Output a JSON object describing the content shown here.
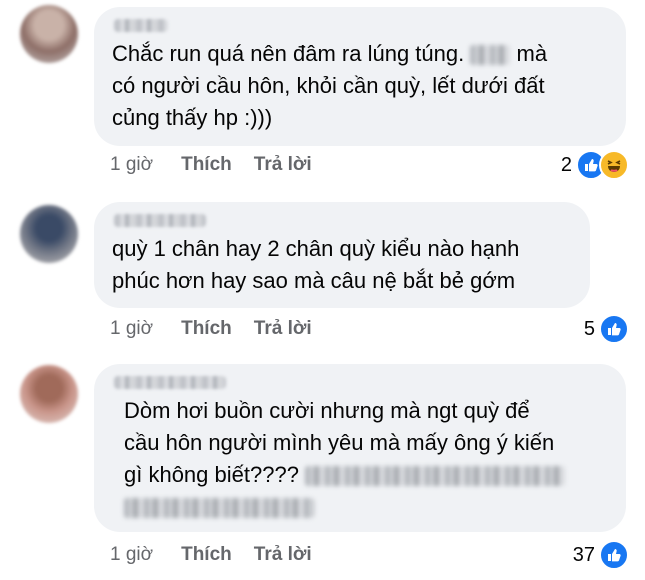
{
  "comments": [
    {
      "text_lines": [
        "Chắc run quá nên đâm ra lúng túng.",
        "mà",
        "có người cầu hôn, khỏi cần quỳ, lết dưới đất",
        "củng thấy hp :)))"
      ],
      "time": "1 giờ",
      "like_label": "Thích",
      "reply_label": "Trả lời",
      "reaction_count": "2",
      "reactions": [
        "like-icon",
        "haha-icon"
      ]
    },
    {
      "text_lines": [
        "quỳ 1 chân hay 2 chân quỳ kiểu nào hạnh",
        "phúc hơn hay sao mà câu nệ bắt bẻ gớm"
      ],
      "time": "1 giờ",
      "like_label": "Thích",
      "reply_label": "Trả lời",
      "reaction_count": "5",
      "reactions": [
        "like-icon"
      ]
    },
    {
      "text_lines": [
        "Dòm hơi buồn cười nhưng mà ngt quỳ để",
        "cầu hôn người mình yêu mà mấy ông ý kiến",
        "gì không biết????"
      ],
      "time": "1 giờ",
      "like_label": "Thích",
      "reply_label": "Trả lời",
      "reaction_count": "37",
      "reactions": [
        "like-icon"
      ]
    }
  ],
  "colors": {
    "bubble": "#f0f2f5",
    "meta_text": "#65676b",
    "like_blue": "#1877f2",
    "haha_yellow": "#f7b928"
  }
}
